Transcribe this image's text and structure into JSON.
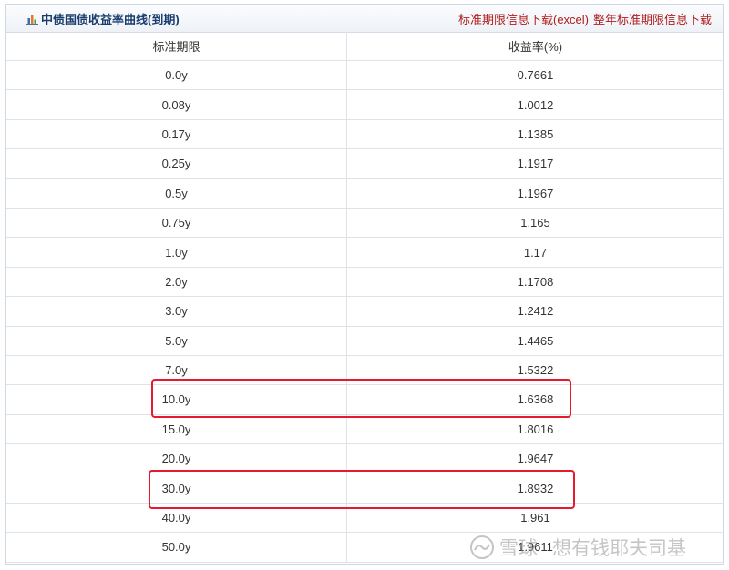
{
  "header": {
    "title": "中债国债收益率曲线(到期)",
    "link_excel": "标准期限信息下载(excel)",
    "link_full_year": "整年标准期限信息下载"
  },
  "table": {
    "columns": [
      "标准期限",
      "收益率(%)"
    ],
    "rows": [
      {
        "term": "0.0y",
        "rate": "0.7661"
      },
      {
        "term": "0.08y",
        "rate": "1.0012"
      },
      {
        "term": "0.17y",
        "rate": "1.1385"
      },
      {
        "term": "0.25y",
        "rate": "1.1917"
      },
      {
        "term": "0.5y",
        "rate": "1.1967"
      },
      {
        "term": "0.75y",
        "rate": "1.165"
      },
      {
        "term": "1.0y",
        "rate": "1.17"
      },
      {
        "term": "2.0y",
        "rate": "1.1708"
      },
      {
        "term": "3.0y",
        "rate": "1.2412"
      },
      {
        "term": "5.0y",
        "rate": "1.4465"
      },
      {
        "term": "7.0y",
        "rate": "1.5322"
      },
      {
        "term": "10.0y",
        "rate": "1.6368",
        "highlighted": true
      },
      {
        "term": "15.0y",
        "rate": "1.8016"
      },
      {
        "term": "20.0y",
        "rate": "1.9647"
      },
      {
        "term": "30.0y",
        "rate": "1.8932",
        "highlighted": true
      },
      {
        "term": "40.0y",
        "rate": "1.961"
      },
      {
        "term": "50.0y",
        "rate": "1.9611"
      }
    ]
  },
  "watermark": {
    "brand": "雪球",
    "author": "想有钱耶夫司基"
  },
  "colors": {
    "title": "#1a3d6e",
    "link": "#b01c1c",
    "highlight": "#e8192c",
    "row_border": "#dfe3e8"
  },
  "icons": {
    "header_icon": "bar-chart-icon",
    "watermark_logo": "snowball-logo"
  }
}
